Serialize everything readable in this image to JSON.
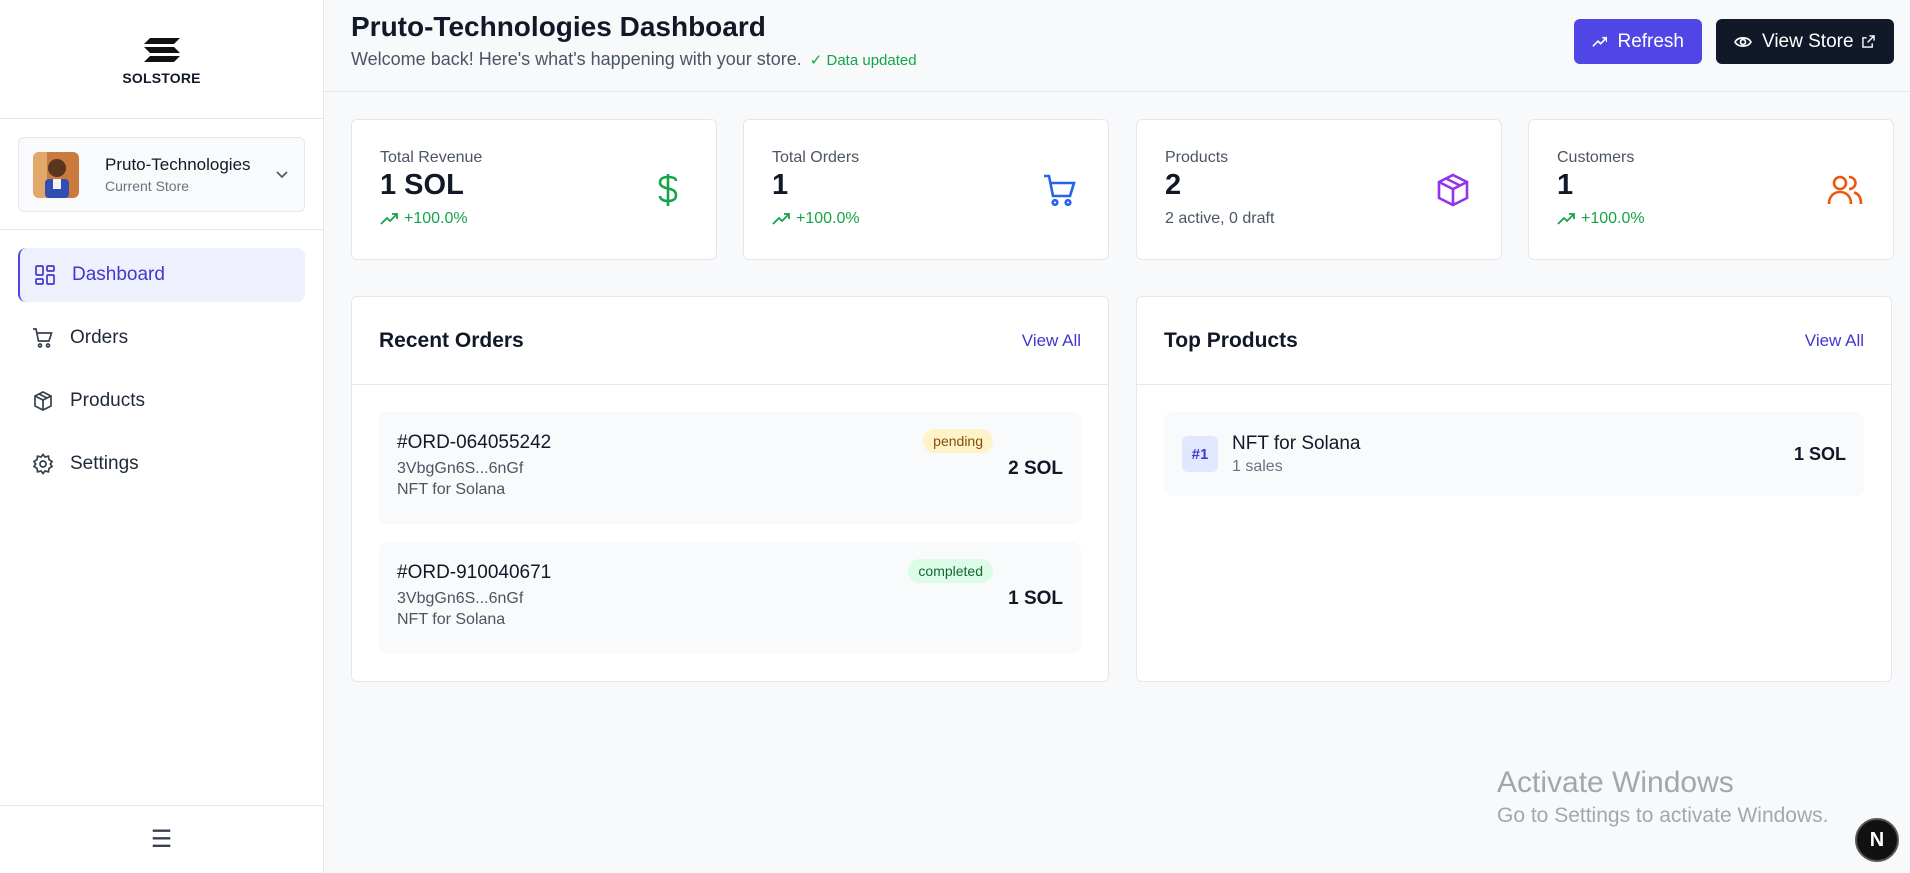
{
  "brand": {
    "name": "SOLSTORE"
  },
  "store": {
    "name": "Pruto-Technologies",
    "sub": "Current Store"
  },
  "nav": [
    {
      "label": "Dashboard",
      "icon": "dashboard-icon",
      "active": true
    },
    {
      "label": "Orders",
      "icon": "cart-icon"
    },
    {
      "label": "Products",
      "icon": "box-icon"
    },
    {
      "label": "Settings",
      "icon": "gear-icon"
    }
  ],
  "footer": {
    "icon": "menu-icon",
    "glyph": "☰"
  },
  "header": {
    "title": "Pruto-Technologies Dashboard",
    "subtitle": "Welcome back! Here's what's happening with your store.",
    "updated": "✓ Data updated",
    "refresh_label": "Refresh",
    "view_store_label": "View Store"
  },
  "stats": [
    {
      "label": "Total Revenue",
      "value": "1 SOL",
      "change": "+100.0%",
      "icon": "dollar-icon",
      "color": "#16a34a"
    },
    {
      "label": "Total Orders",
      "value": "1",
      "change": "+100.0%",
      "icon": "cart-icon",
      "color": "#2563eb"
    },
    {
      "label": "Products",
      "value": "2",
      "sub": "2 active, 0 draft",
      "icon": "box-icon",
      "color": "#9333ea"
    },
    {
      "label": "Customers",
      "value": "1",
      "change": "+100.0%",
      "icon": "users-icon",
      "color": "#ea580c"
    }
  ],
  "recent_orders": {
    "title": "Recent Orders",
    "view_all": "View All",
    "items": [
      {
        "id": "#ORD-064055242",
        "wallet": "3VbgGn6S...6nGf",
        "product": "NFT for Solana",
        "status": "pending",
        "amount": "2 SOL"
      },
      {
        "id": "#ORD-910040671",
        "wallet": "3VbgGn6S...6nGf",
        "product": "NFT for Solana",
        "status": "completed",
        "amount": "1 SOL"
      }
    ]
  },
  "top_products": {
    "title": "Top Products",
    "view_all": "View All",
    "items": [
      {
        "rank": "#1",
        "name": "NFT for Solana",
        "sales": "1 sales",
        "amount": "1 SOL"
      }
    ]
  },
  "watermark": {
    "title": "Activate Windows",
    "sub": "Go to Settings to activate Windows."
  },
  "next_badge": "N"
}
